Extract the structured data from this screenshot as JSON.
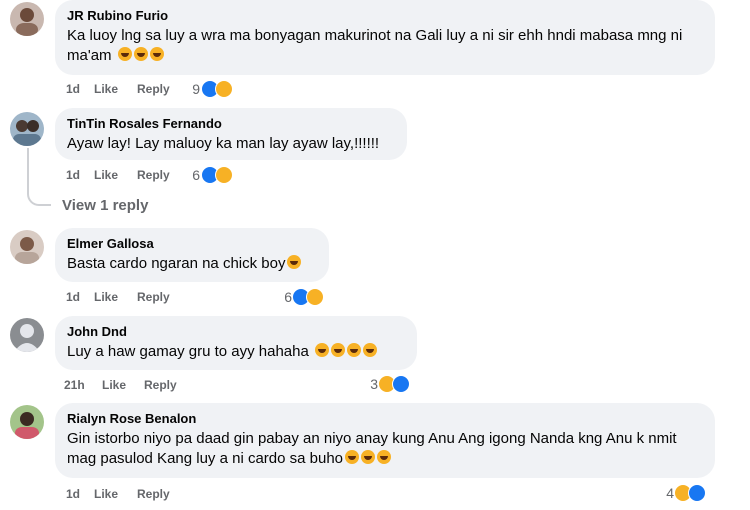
{
  "comments": [
    {
      "author": "JR Rubino Furio",
      "text": "Ka luoy lng sa luy a wra ma bonyagan makurinot na Gali luy a ni sir ehh hndi mabasa mng ni ma'am",
      "emoji_count": 3,
      "time": "1d",
      "like_label": "Like",
      "reply_label": "Reply",
      "reaction_count": "9",
      "reactions": [
        "like-icon",
        "haha-icon"
      ]
    },
    {
      "author": "TinTin Rosales Fernando",
      "text": "Ayaw lay! Lay maluoy ka man lay ayaw lay,!!!!!!",
      "emoji_count": 0,
      "time": "1d",
      "like_label": "Like",
      "reply_label": "Reply",
      "reaction_count": "6",
      "reactions": [
        "like-icon",
        "haha-icon"
      ]
    },
    {
      "author": "Elmer Gallosa",
      "text": "Basta cardo ngaran na chick boy",
      "emoji_count": 1,
      "time": "1d",
      "like_label": "Like",
      "reply_label": "Reply",
      "reaction_count": "6",
      "reactions": [
        "like-icon",
        "haha-icon"
      ]
    },
    {
      "author": "John Dnd",
      "text": "Luy a haw gamay gru to ayy hahaha",
      "emoji_count": 4,
      "time": "21h",
      "like_label": "Like",
      "reply_label": "Reply",
      "reaction_count": "3",
      "reactions": [
        "haha-icon",
        "like-icon"
      ]
    },
    {
      "author": "Rialyn Rose Benalon",
      "text": "Gin istorbo niyo pa daad gin pabay an niyo anay kung Anu Ang igong Nanda kng Anu k nmit mag pasulod Kang luy a ni cardo sa buho",
      "emoji_count": 3,
      "time": "1d",
      "like_label": "Like",
      "reply_label": "Reply",
      "reaction_count": "4",
      "reactions": [
        "haha-icon",
        "like-icon"
      ]
    }
  ],
  "view_replies_label": "View 1 reply",
  "colors": {
    "bubble": "#f0f2f5",
    "meta_text": "#65676b",
    "like_blue": "#1877f2",
    "haha_yellow": "#f7b125"
  }
}
